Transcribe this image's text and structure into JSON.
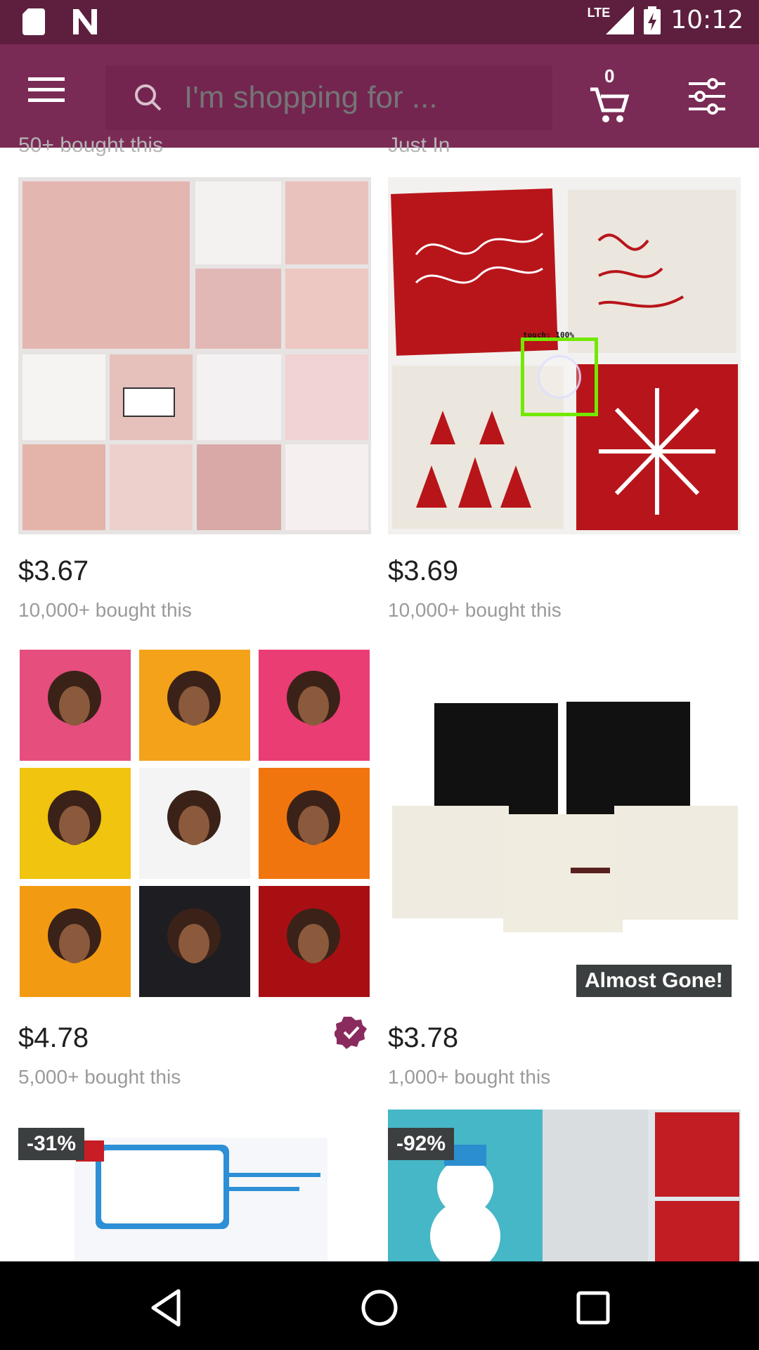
{
  "status_bar": {
    "network": "LTE",
    "time": "10:12"
  },
  "toolbar": {
    "search_placeholder": "I'm shopping for ...",
    "cart_count": "0"
  },
  "peek": {
    "left": "50+ bought this",
    "right": "Just In"
  },
  "products": [
    {
      "price": "$3.67",
      "sold": "10,000+ bought this"
    },
    {
      "price": "$3.69",
      "sold": "10,000+ bought this"
    },
    {
      "price": "$4.78",
      "sold": "5,000+ bought this"
    },
    {
      "price": "$3.78",
      "sold": "1,000+ bought this",
      "badge": "Almost Gone!"
    },
    {
      "discount": "-31%"
    },
    {
      "discount": "-92%"
    }
  ],
  "touch_overlay": {
    "label": "touch: 100%"
  },
  "colors": {
    "status": "#5e1f3f",
    "toolbar": "#7a2b55",
    "accent": "#8a2b5e"
  }
}
